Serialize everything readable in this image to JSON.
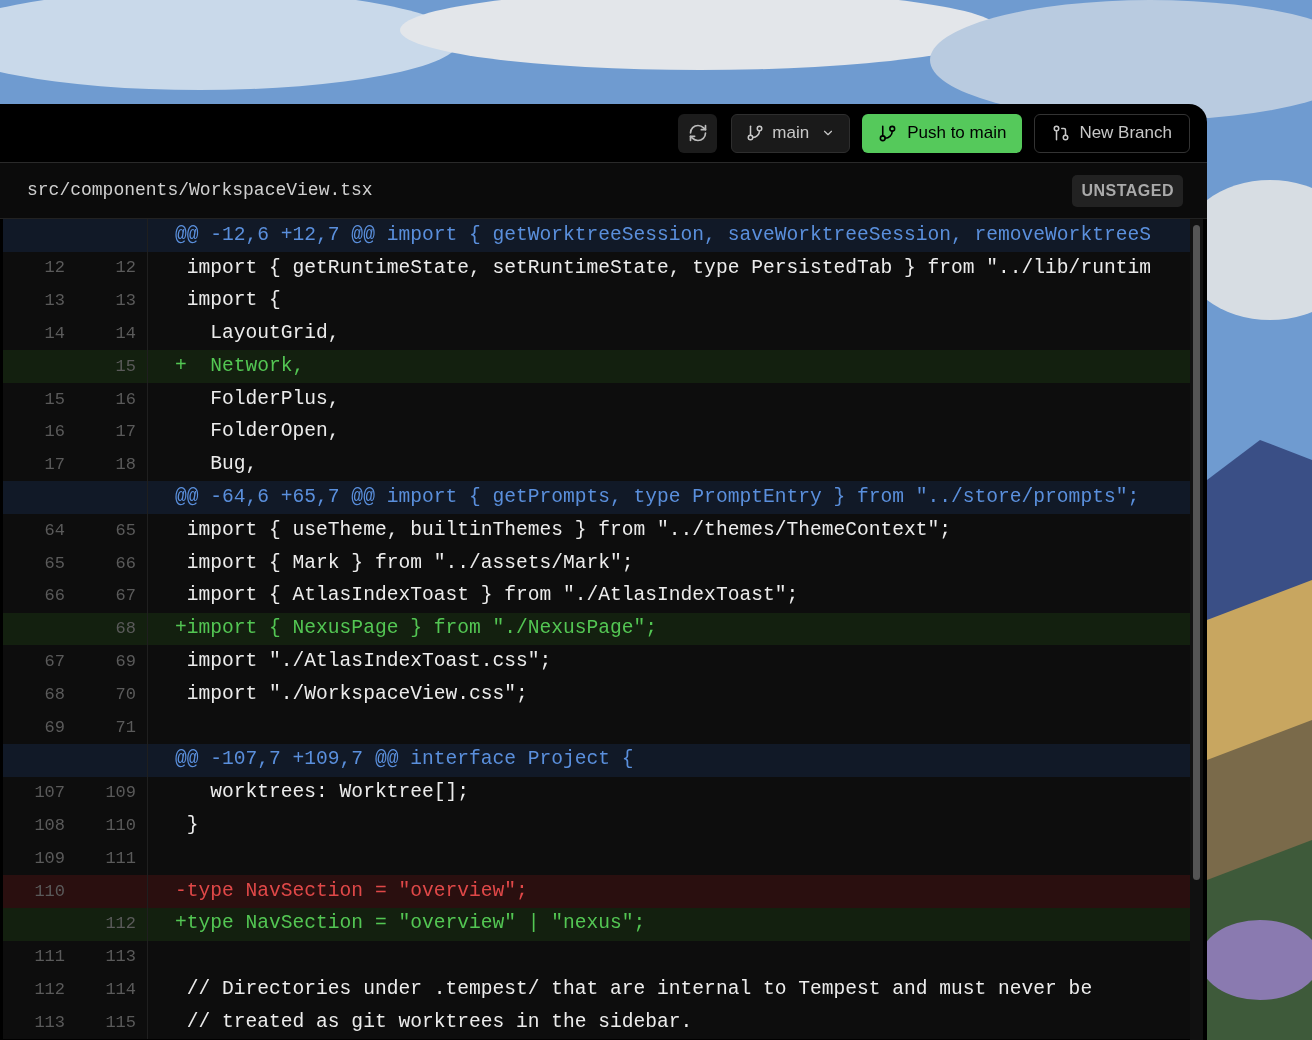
{
  "toolbar": {
    "branch": "main",
    "push_label": "Push to main",
    "new_branch_label": "New Branch"
  },
  "file": {
    "path": "src/components/WorkspaceView.tsx",
    "status": "UNSTAGED"
  },
  "diff": [
    {
      "kind": "hunk",
      "line": "@@ -12,6 +12,7 @@ import { getWorktreeSession, saveWorktreeSession, removeWorktreeS"
    },
    {
      "kind": "context",
      "old": "12",
      "new": "12",
      "line": " import { getRuntimeState, setRuntimeState, type PersistedTab } from \"../lib/runtim"
    },
    {
      "kind": "context",
      "old": "13",
      "new": "13",
      "line": " import {"
    },
    {
      "kind": "context",
      "old": "14",
      "new": "14",
      "line": "   LayoutGrid,"
    },
    {
      "kind": "add",
      "new": "15",
      "line": "+  Network,"
    },
    {
      "kind": "context",
      "old": "15",
      "new": "16",
      "line": "   FolderPlus,"
    },
    {
      "kind": "context",
      "old": "16",
      "new": "17",
      "line": "   FolderOpen,"
    },
    {
      "kind": "context",
      "old": "17",
      "new": "18",
      "line": "   Bug,"
    },
    {
      "kind": "hunk",
      "line": "@@ -64,6 +65,7 @@ import { getPrompts, type PromptEntry } from \"../store/prompts\";"
    },
    {
      "kind": "context",
      "old": "64",
      "new": "65",
      "line": " import { useTheme, builtinThemes } from \"../themes/ThemeContext\";"
    },
    {
      "kind": "context",
      "old": "65",
      "new": "66",
      "line": " import { Mark } from \"../assets/Mark\";"
    },
    {
      "kind": "context",
      "old": "66",
      "new": "67",
      "line": " import { AtlasIndexToast } from \"./AtlasIndexToast\";"
    },
    {
      "kind": "add",
      "new": "68",
      "line": "+import { NexusPage } from \"./NexusPage\";"
    },
    {
      "kind": "context",
      "old": "67",
      "new": "69",
      "line": " import \"./AtlasIndexToast.css\";"
    },
    {
      "kind": "context",
      "old": "68",
      "new": "70",
      "line": " import \"./WorkspaceView.css\";"
    },
    {
      "kind": "context",
      "old": "69",
      "new": "71"
    },
    {
      "kind": "hunk",
      "line": "@@ -107,7 +109,7 @@ interface Project {"
    },
    {
      "kind": "context",
      "old": "107",
      "new": "109",
      "line": "   worktrees: Worktree[];"
    },
    {
      "kind": "context",
      "old": "108",
      "new": "110",
      "line": " }"
    },
    {
      "kind": "context",
      "old": "109",
      "new": "111"
    },
    {
      "kind": "del",
      "old": "110",
      "line": "-type NavSection = \"overview\";"
    },
    {
      "kind": "add",
      "new": "112",
      "line": "+type NavSection = \"overview\" | \"nexus\";"
    },
    {
      "kind": "context",
      "old": "111",
      "new": "113"
    },
    {
      "kind": "context",
      "old": "112",
      "new": "114",
      "line": " // Directories under .tempest/ that are internal to Tempest and must never be"
    },
    {
      "kind": "context",
      "old": "113",
      "new": "115",
      "line": " // treated as git worktrees in the sidebar."
    }
  ]
}
